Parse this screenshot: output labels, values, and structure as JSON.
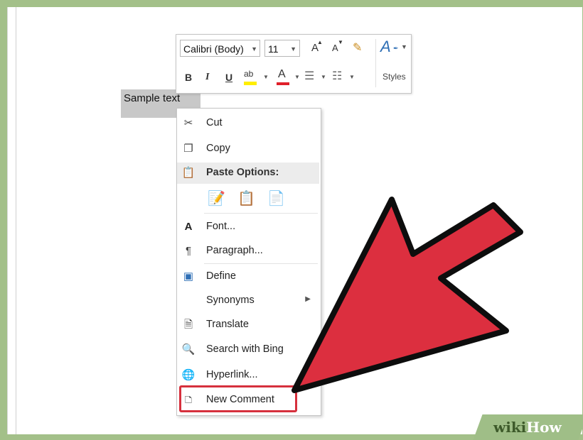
{
  "document": {
    "selected_text": "Sample text"
  },
  "mini_toolbar": {
    "font_name": "Calibri (Body)",
    "font_size": "11",
    "grow_font": "A",
    "shrink_font": "A",
    "bold": "B",
    "italic": "I",
    "underline": "U",
    "highlight": "ab",
    "font_color": "A",
    "styles_label": "Styles"
  },
  "context_menu": {
    "items": [
      {
        "label": "Cut",
        "icon": "scissors-icon"
      },
      {
        "label": "Copy",
        "icon": "copy-icon"
      },
      {
        "label": "Paste Options:",
        "icon": "clipboard-icon"
      },
      {
        "label": "Font...",
        "icon": "font-icon"
      },
      {
        "label": "Paragraph...",
        "icon": "paragraph-icon"
      },
      {
        "label": "Define",
        "icon": "define-icon"
      },
      {
        "label": "Synonyms",
        "icon": "none"
      },
      {
        "label": "Translate",
        "icon": "translate-icon"
      },
      {
        "label": "Search with Bing",
        "icon": "search-globe-icon"
      },
      {
        "label": "Hyperlink...",
        "icon": "hyperlink-icon"
      },
      {
        "label": "New Comment",
        "icon": "comment-icon"
      }
    ]
  },
  "colors": {
    "highlight_border": "#d6303d",
    "arrow_fill": "#dc2f3f",
    "frame_green": "#a3c089"
  },
  "watermark": {
    "wiki": "wiki",
    "how": "How"
  }
}
